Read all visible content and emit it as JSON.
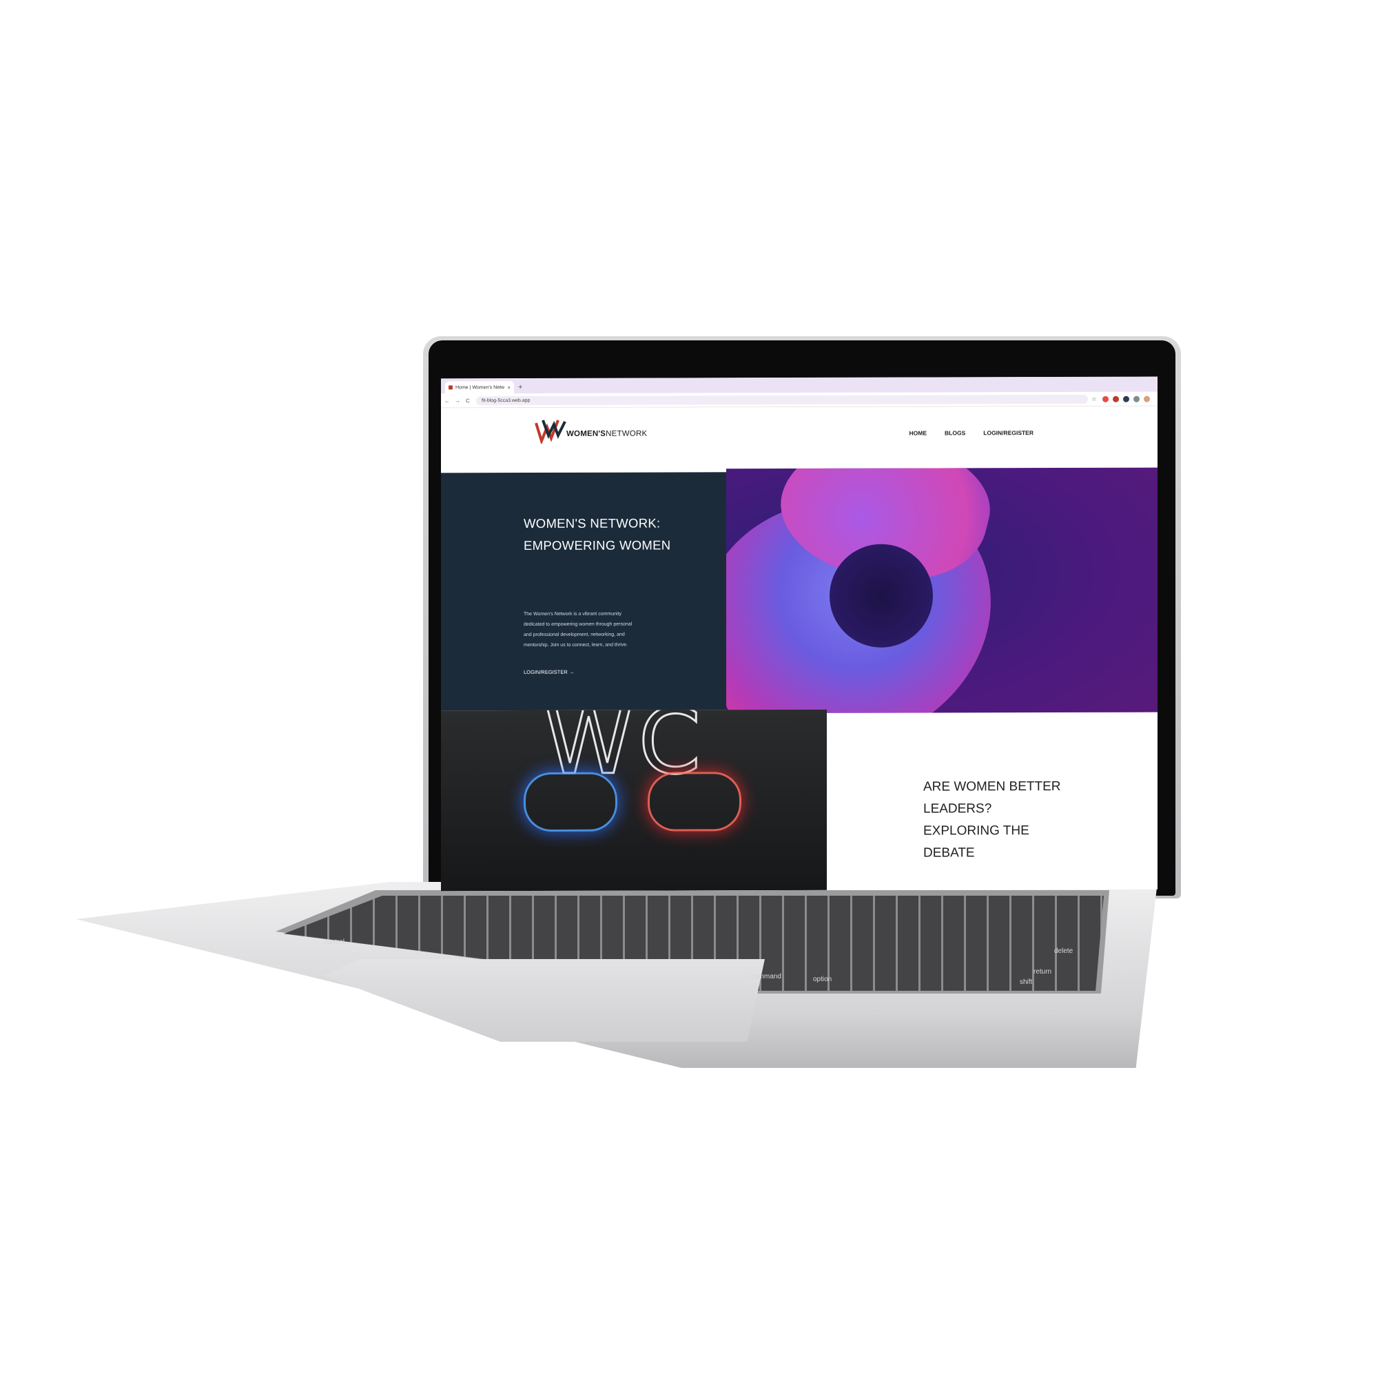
{
  "browser": {
    "tab_title": "Home | Women's Network",
    "tab_close": "×",
    "new_tab": "+",
    "url": "fit-blog-5cca3.web.app",
    "back": "←",
    "forward": "→",
    "reload": "C",
    "star": "☆"
  },
  "site": {
    "logo_text_bold": "WOMEN'S",
    "logo_text_rest": "NETWORK",
    "nav": [
      "HOME",
      "BLOGS",
      "LOGIN/REGISTER"
    ],
    "hero": {
      "title": "WOMEN'S NETWORK: EMPOWERING WOMEN",
      "description": "The Women's Network is a vibrant community dedicated to empowering women through personal and professional development, networking, and mentorship. Join us to connect, learn, and thrive.",
      "cta": "LOGIN/REGISTER →"
    },
    "blog_feature": {
      "neon_text": "WC",
      "title": "ARE WOMEN BETTER LEADERS? EXPLORING THE DEBATE"
    }
  },
  "keyboard": {
    "labels": [
      "command",
      "option",
      "control",
      "shift",
      "return",
      "delete"
    ]
  },
  "colors": {
    "hero_bg": "#1c2b3a",
    "logo_red": "#c0392b",
    "logo_navy": "#1c2b3a",
    "tabbar": "#ece2f6"
  }
}
